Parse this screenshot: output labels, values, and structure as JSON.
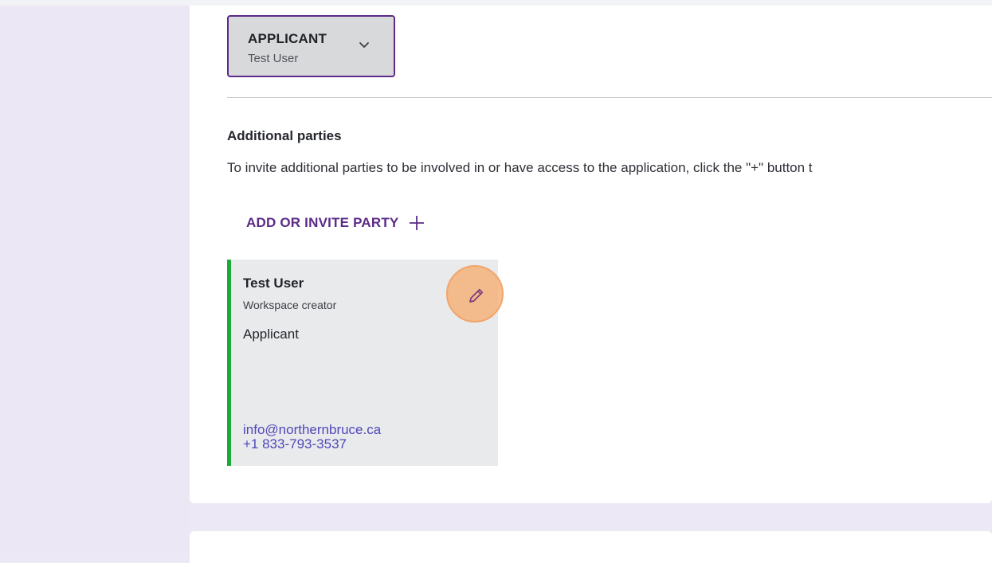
{
  "role_selector": {
    "title": "APPLICANT",
    "subtitle": "Test User"
  },
  "additional_parties": {
    "heading": "Additional parties",
    "description": "To invite additional parties to be involved in or have access to the application, click the \"+\" button t",
    "add_button_label": "ADD OR INVITE PARTY"
  },
  "party_card": {
    "name": "Test User",
    "note": "Workspace creator",
    "role": "Applicant",
    "email": "info@northernbruce.ca",
    "phone": "+1 833-793-3537"
  },
  "colors": {
    "accent": "#5b2b87",
    "card_border": "#1aaa3a",
    "link": "#4f47b8",
    "highlight": "#f6ac70"
  },
  "icons": [
    "chevron-down-icon",
    "plus-icon",
    "pencil-icon"
  ]
}
